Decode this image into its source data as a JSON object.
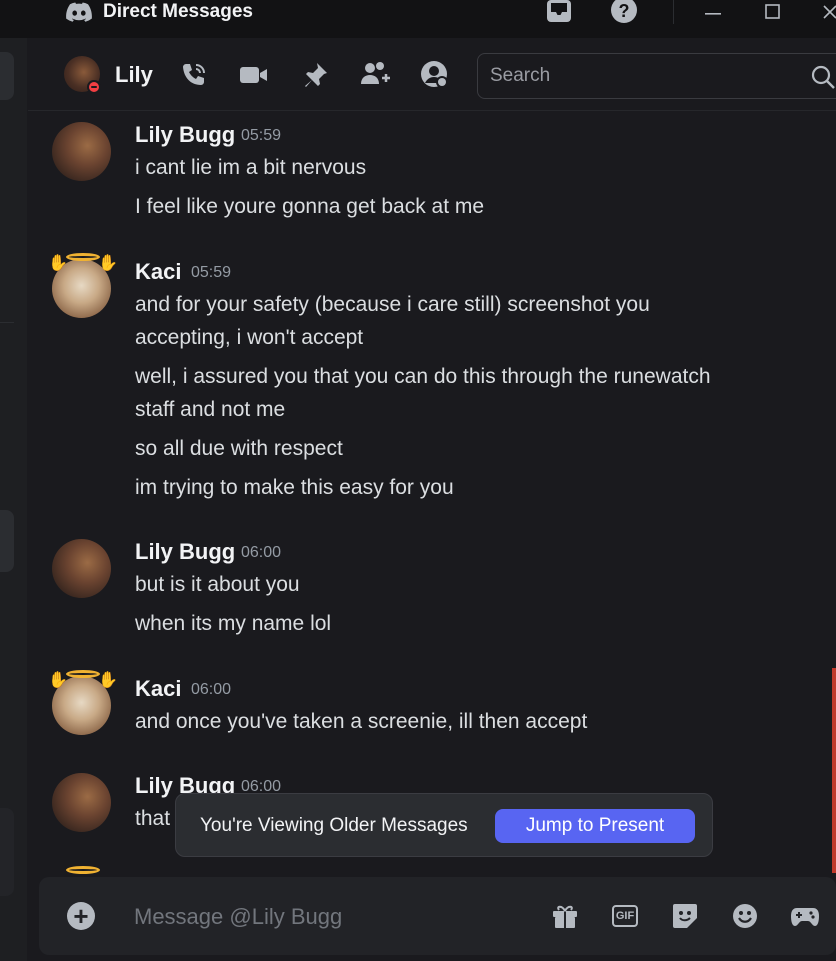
{
  "titlebar": {
    "title": "Direct Messages"
  },
  "header": {
    "user_name": "Lily",
    "search_placeholder": "Search"
  },
  "messages": [
    {
      "author": "Lily Bugg",
      "time": "05:59",
      "lines": [
        "i cant lie im a bit nervous",
        "I feel like youre gonna get back at me"
      ]
    },
    {
      "author": "Kaci",
      "time": "05:59",
      "lines": [
        "and for your safety (because i care still) screenshot you",
        "accepting, i won't accept",
        "well, i assured you that you can do this through the runewatch",
        "staff and not me",
        "so all due with respect",
        "im trying to make this easy for you"
      ]
    },
    {
      "author": "Lily Bugg",
      "time": "06:00",
      "lines": [
        "but is it about you",
        "when its my name lol"
      ]
    },
    {
      "author": "Kaci",
      "time": "06:00",
      "lines": [
        "and once you've taken a screenie, ill then accept"
      ]
    },
    {
      "author": "Lily Bugg",
      "time": "06:00",
      "lines": [
        "that"
      ]
    }
  ],
  "older_bar": {
    "text": "You're Viewing Older Messages",
    "button": "Jump to Present"
  },
  "composer": {
    "placeholder": "Message @Lily Bugg",
    "gif_label": "GIF"
  },
  "colors": {
    "accent": "#5865f2",
    "dnd": "#f23f43",
    "halo": "#f0b232"
  }
}
